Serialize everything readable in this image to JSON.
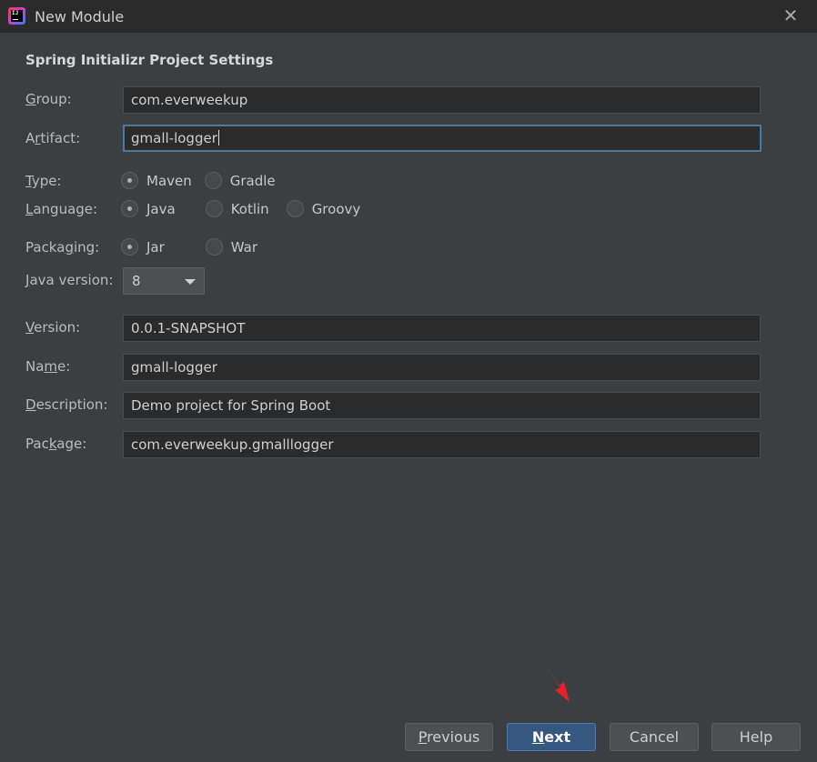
{
  "window": {
    "title": "New Module"
  },
  "section_title": "Spring Initializr Project Settings",
  "fields": {
    "group": {
      "label_mnemonic": "G",
      "label_rest": "roup:",
      "value": "com.everweekup"
    },
    "artifact": {
      "label_pre": "A",
      "label_mnemonic": "r",
      "label_rest": "tifact:",
      "value": "gmall-logger"
    },
    "version": {
      "label_mnemonic": "V",
      "label_rest": "ersion:",
      "value": "0.0.1-SNAPSHOT"
    },
    "name": {
      "label_pre": "Na",
      "label_mnemonic": "m",
      "label_rest": "e:",
      "value": "gmall-logger"
    },
    "description": {
      "label_mnemonic": "D",
      "label_rest": "escription:",
      "value": "Demo project for Spring Boot"
    },
    "package": {
      "label_pre": "Pac",
      "label_mnemonic": "k",
      "label_rest": "age:",
      "value": "com.everweekup.gmalllogger"
    }
  },
  "type": {
    "label_mnemonic": "T",
    "label_rest": "ype:",
    "options": [
      {
        "label": "Maven",
        "checked": true
      },
      {
        "label": "Gradle",
        "checked": false
      }
    ]
  },
  "language": {
    "label_mnemonic": "L",
    "label_rest": "anguage:",
    "options": [
      {
        "label": "Java",
        "checked": true
      },
      {
        "label": "Kotlin",
        "checked": false
      },
      {
        "label": "Groovy",
        "checked": false
      }
    ]
  },
  "packaging": {
    "label_pre": "Packa",
    "label_mnemonic": "g",
    "label_rest": "ing:",
    "options": [
      {
        "label": "Jar",
        "checked": true
      },
      {
        "label": "War",
        "checked": false
      }
    ]
  },
  "java_version": {
    "label_mnemonic": "J",
    "label_rest": "ava version:",
    "selected": "8"
  },
  "buttons": {
    "previous": {
      "mnemonic": "P",
      "rest": "revious"
    },
    "next": {
      "mnemonic": "N",
      "rest": "ext"
    },
    "cancel": "Cancel",
    "help": "Help"
  },
  "colors": {
    "background": "#3c3f41",
    "field_bg": "#2b2b2b",
    "focus_border": "#4679a4",
    "primary_button": "#365880",
    "annotation_arrow": "#e8202a"
  }
}
